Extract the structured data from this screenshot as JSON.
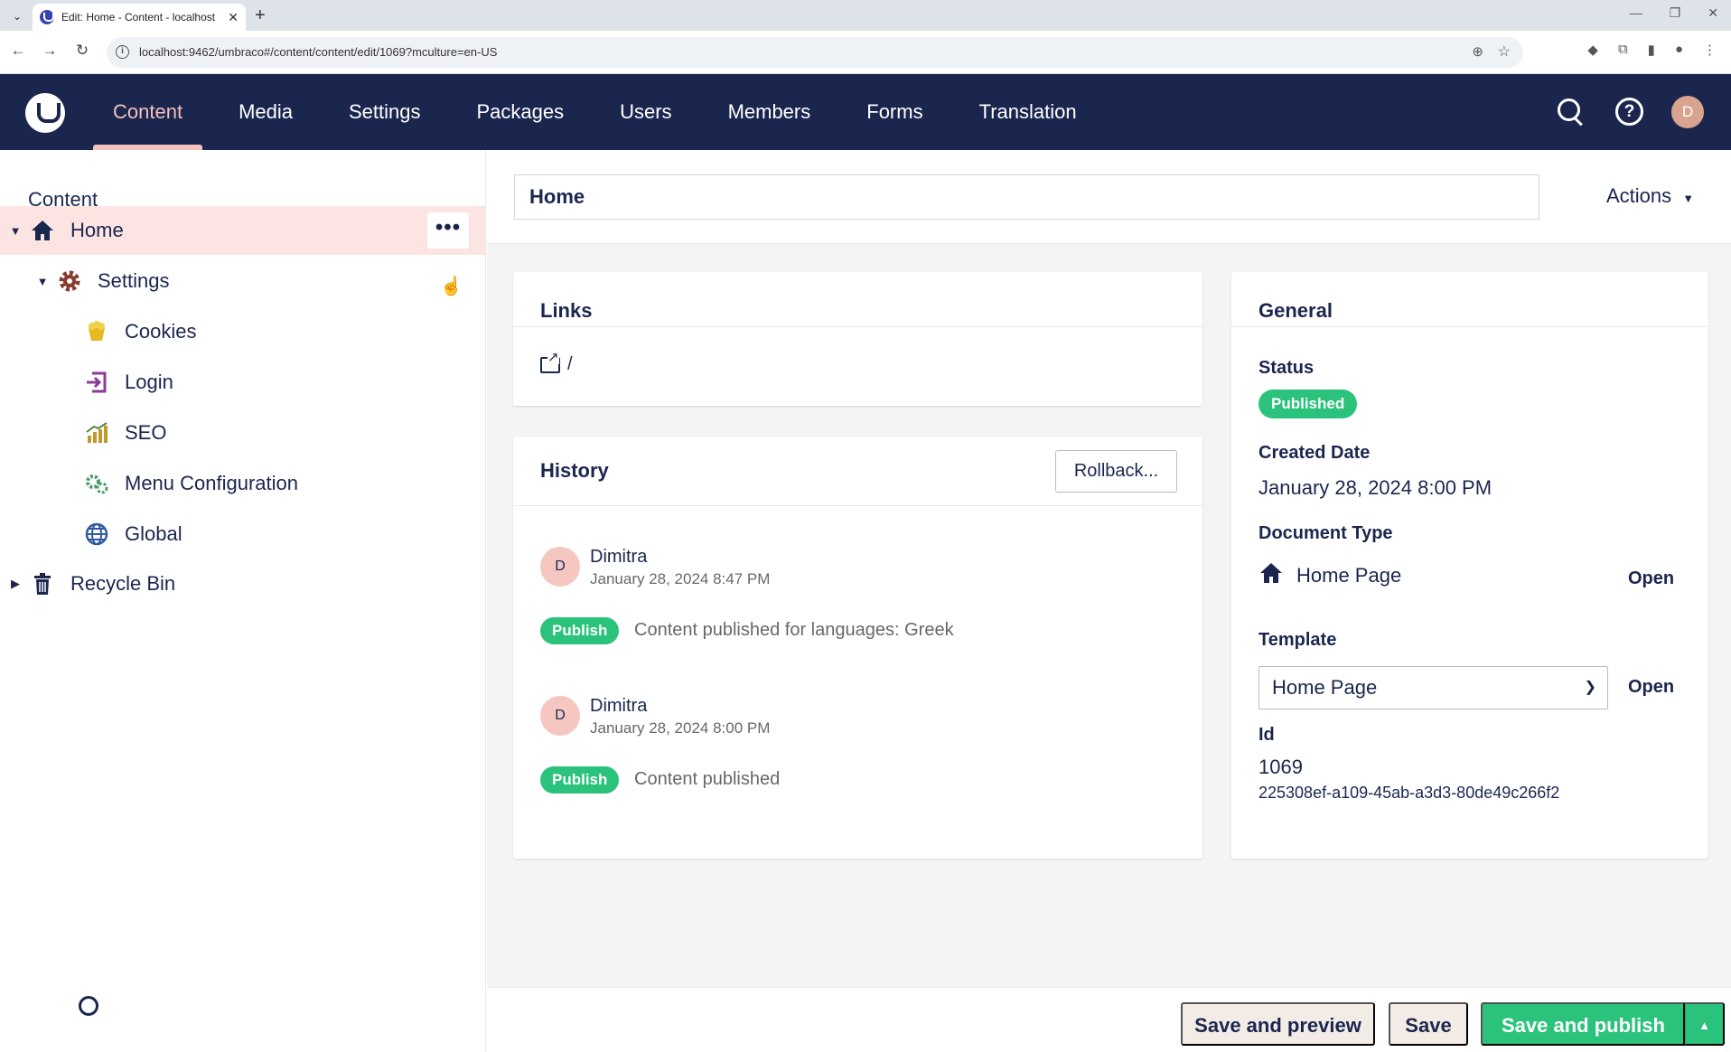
{
  "browser": {
    "tab_title": "Edit: Home - Content - localhost",
    "url": "localhost:9462/umbraco#/content/content/edit/1069?mculture=en-US"
  },
  "header": {
    "nav": [
      "Content",
      "Media",
      "Settings",
      "Packages",
      "Users",
      "Members",
      "Forms",
      "Translation"
    ],
    "active_nav": "Content",
    "avatar_initial": "D",
    "help_glyph": "?"
  },
  "sidebar": {
    "title": "Content",
    "tree": [
      {
        "label": "Home",
        "icon": "home-icon",
        "selected": true
      },
      {
        "label": "Settings",
        "icon": "gear-icon"
      },
      {
        "label": "Cookies",
        "icon": "cookies-icon"
      },
      {
        "label": "Login",
        "icon": "login-icon"
      },
      {
        "label": "SEO",
        "icon": "chart-icon"
      },
      {
        "label": "Menu Configuration",
        "icon": "cogs-icon"
      },
      {
        "label": "Global",
        "icon": "globe-icon"
      },
      {
        "label": "Recycle Bin",
        "icon": "trash-icon"
      }
    ]
  },
  "editor": {
    "name_value": "Home",
    "actions_label": "Actions"
  },
  "links": {
    "title": "Links",
    "url": "/"
  },
  "history": {
    "title": "History",
    "rollback_label": "Rollback...",
    "entries": [
      {
        "avatar": "D",
        "user": "Dimitra",
        "date": "January 28, 2024 8:47 PM",
        "badge": "Publish",
        "message": "Content published for languages: Greek"
      },
      {
        "avatar": "D",
        "user": "Dimitra",
        "date": "January 28, 2024 8:00 PM",
        "badge": "Publish",
        "message": "Content published"
      }
    ]
  },
  "general": {
    "title": "General",
    "status_label": "Status",
    "status_value": "Published",
    "created_label": "Created Date",
    "created_value": "January 28, 2024 8:00 PM",
    "doctype_label": "Document Type",
    "doctype_value": "Home Page",
    "template_label": "Template",
    "template_value": "Home Page",
    "open_label": "Open",
    "id_label": "Id",
    "id_value": "1069",
    "guid_value": "225308ef-a109-45ab-a3d3-80de49c266f2"
  },
  "bottom_bar": {
    "save_preview_label": "Save and preview",
    "save_label": "Save",
    "save_publish_label": "Save and publish"
  },
  "colors": {
    "header_bg": "#1b264f",
    "accent_pink": "#f5c1bc",
    "success_green": "#2bc37c",
    "selected_row": "#fbe4e2"
  }
}
